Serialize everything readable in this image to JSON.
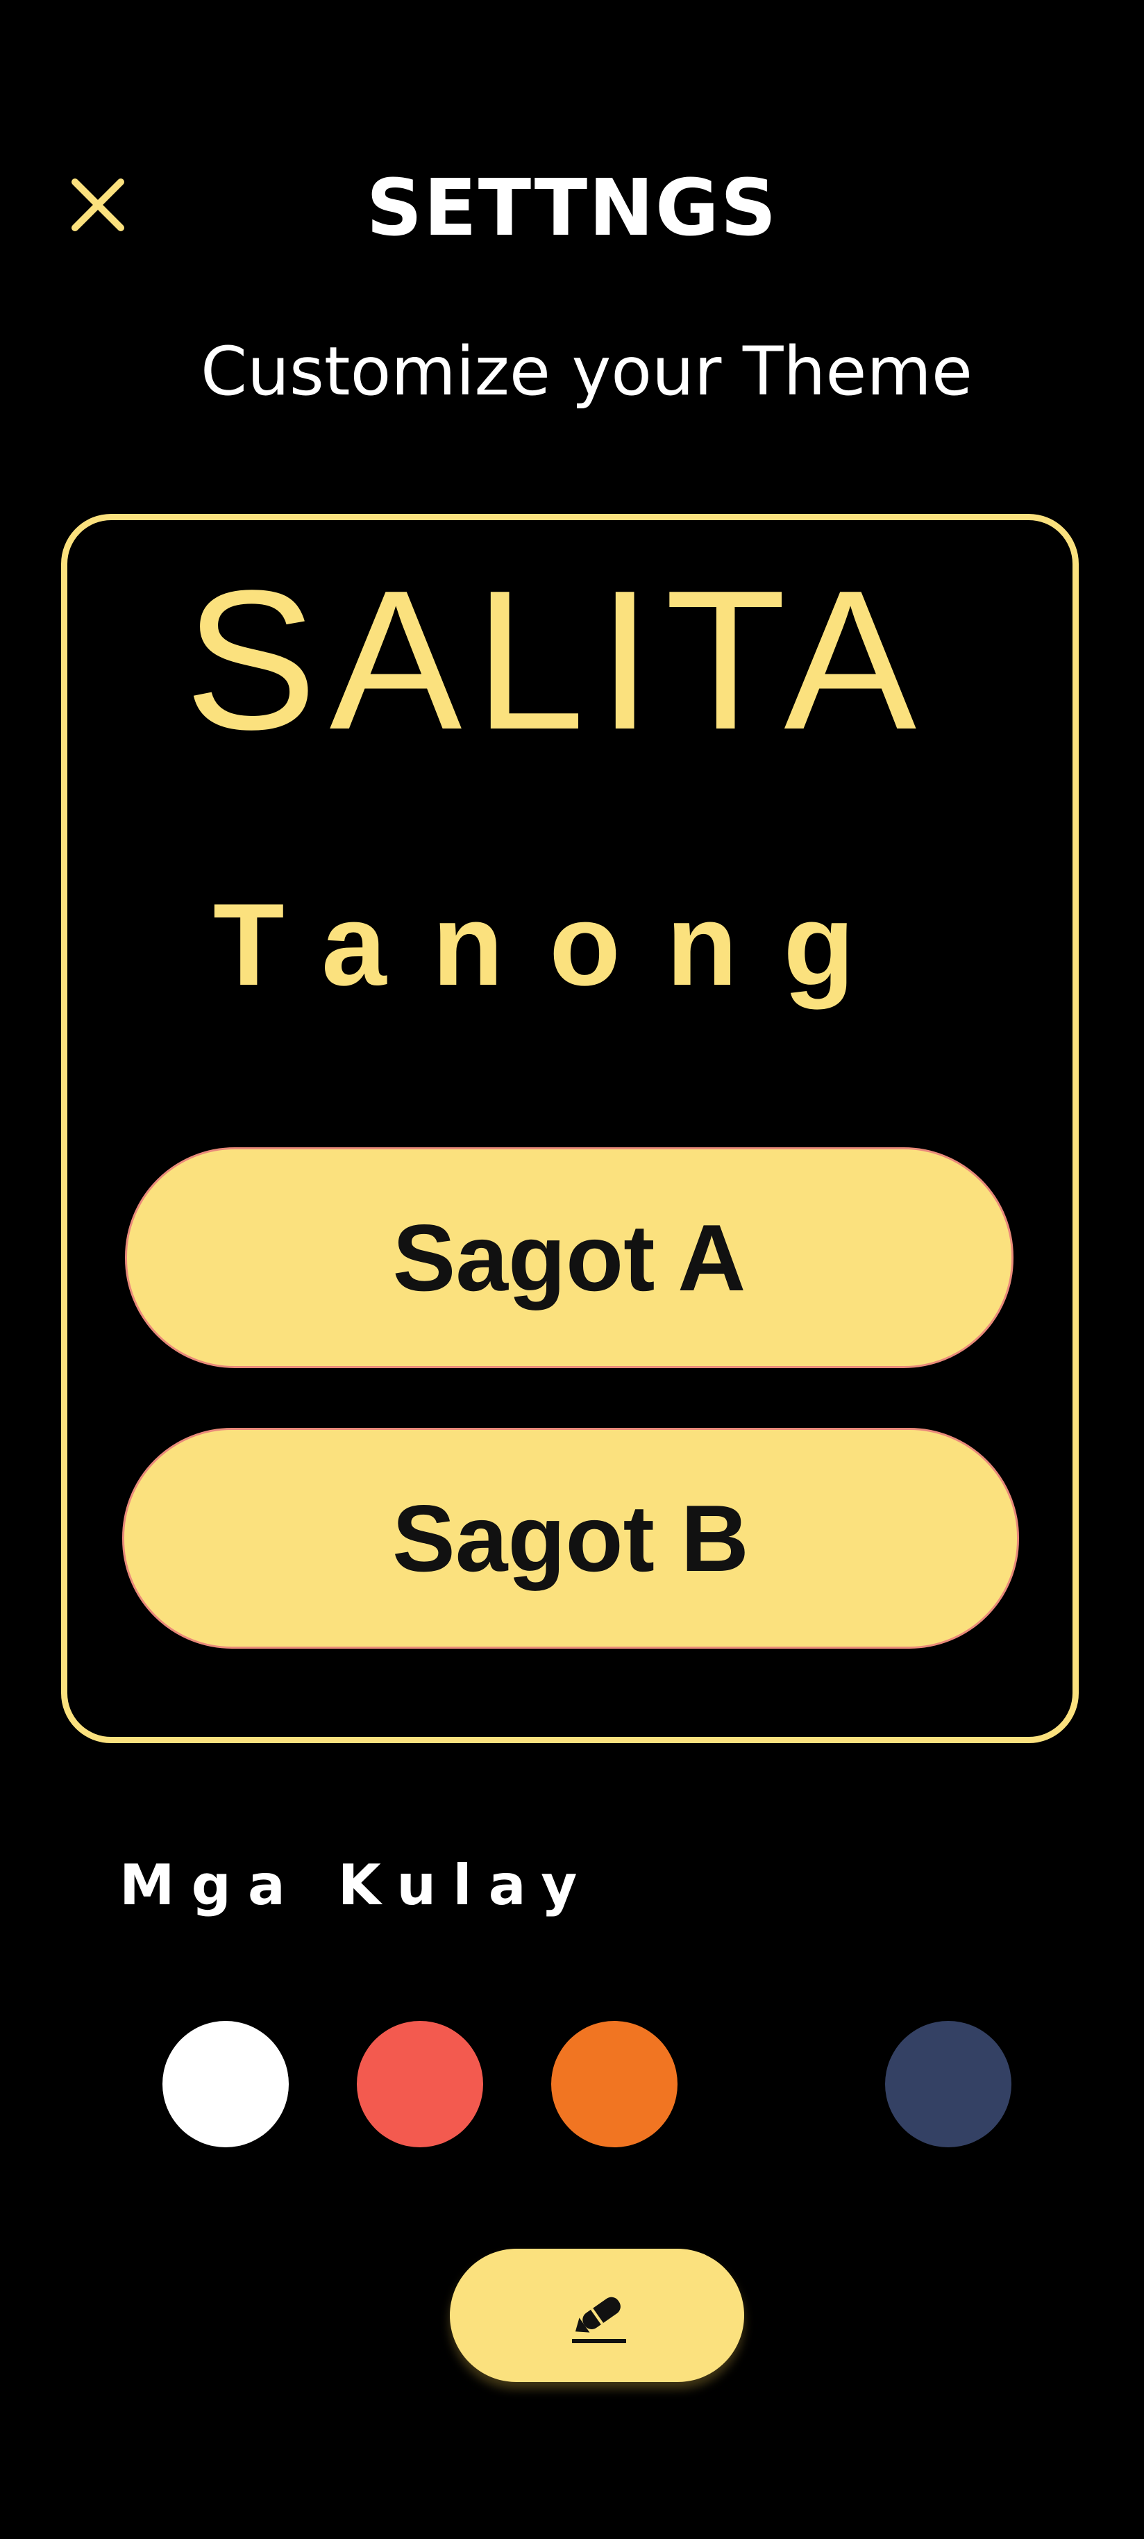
{
  "header": {
    "title": "SETTNGS",
    "subtitle": "Customize your Theme",
    "close_icon": "close-icon"
  },
  "preview": {
    "brand": "SALITA",
    "question": "Tanong",
    "answers": [
      {
        "label": "Sagot A"
      },
      {
        "label": "Sagot B"
      }
    ]
  },
  "colors": {
    "label": "Mga Kulay",
    "swatches": [
      {
        "name": "white",
        "hex": "#ffffff"
      },
      {
        "name": "coral-red",
        "hex": "#f35a4f"
      },
      {
        "name": "orange",
        "hex": "#f17522"
      },
      {
        "name": "navy",
        "hex": "#344164"
      }
    ]
  },
  "theme": {
    "accent": "#fbe17e",
    "background": "#000000",
    "text": "#ffffff"
  },
  "edit_button": {
    "icon": "pencil-edit-icon"
  }
}
